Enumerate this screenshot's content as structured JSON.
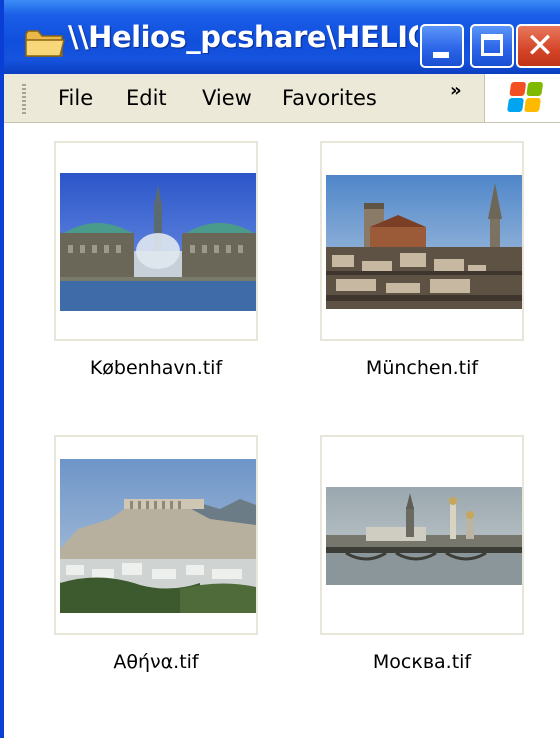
{
  "window": {
    "title": "\\\\Helios_pcshare\\HELIO...",
    "title_color": "#0f4fdc"
  },
  "menu": {
    "items": [
      "File",
      "Edit",
      "View",
      "Favorites"
    ],
    "overflow": "»"
  },
  "files": [
    {
      "name": "København.tif"
    },
    {
      "name": "München.tif"
    },
    {
      "name": "Αθήνα.tif"
    },
    {
      "name": "Москва.tif"
    }
  ]
}
